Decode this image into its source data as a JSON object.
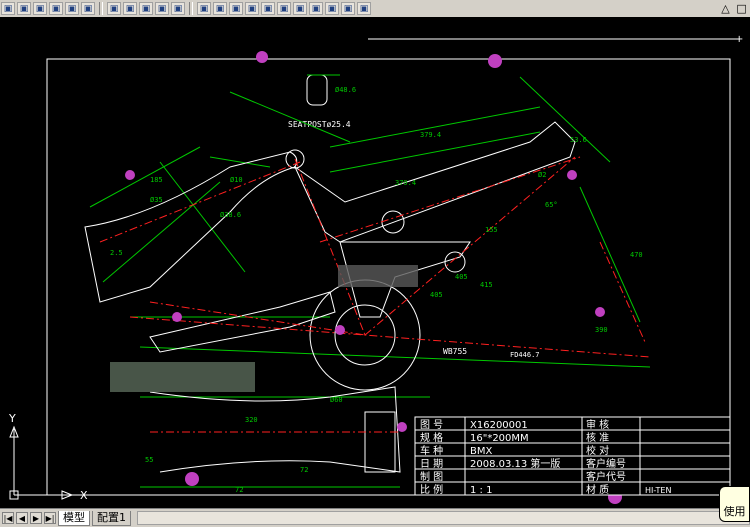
{
  "colors": {
    "bg": "#000000",
    "green": "#00c800",
    "red": "#ff2020",
    "white": "#ffffff",
    "cyan": "#00c8c8",
    "magenta": "#c040c0",
    "yellow": "#ffff00"
  },
  "toolbar": {
    "icons": [
      "box-icon",
      "wedge-icon",
      "cone-icon",
      "sphere-icon",
      "cylinder-icon",
      "torus-icon",
      "layer-icon",
      "view-icon",
      "render-icon",
      "light-icon",
      "material-icon",
      "top-view-icon",
      "bottom-view-icon",
      "left-view-icon",
      "right-view-icon",
      "front-view-icon",
      "back-view-icon",
      "iso-sw-icon",
      "iso-se-icon",
      "iso-ne-icon",
      "iso-nw-icon",
      "camera-icon"
    ]
  },
  "drawing": {
    "seatpost_label": "SEATPOSTø25.4",
    "wb_label": "WB755",
    "dims": [
      "379.4",
      "379.4",
      "FD446.7",
      "Ø48.6",
      "185",
      "Ø35",
      "Ø10",
      "Ø38.6",
      "53.6",
      "Ø2",
      "470",
      "155",
      "320",
      "72",
      "72",
      "55",
      "405",
      "405",
      "415",
      "65°",
      "390",
      "Ø60",
      "2.5"
    ],
    "title_block": {
      "rows": [
        {
          "l1": "图  号",
          "v1": "X16200001",
          "l2": "审  核",
          "v2": ""
        },
        {
          "l1": "规  格",
          "v1": "16\"*200MM",
          "l2": "核  准",
          "v2": ""
        },
        {
          "l1": "车  种",
          "v1": "BMX",
          "l2": "校  对",
          "v2": ""
        },
        {
          "l1": "日  期",
          "v1": "2008.03.13  第一版",
          "l2": "客户编号",
          "v2": ""
        },
        {
          "l1": "制  图",
          "v1": "",
          "l2": "客户代号",
          "v2": ""
        },
        {
          "l1": "比  例",
          "v1": "1 : 1",
          "l2": "材  质",
          "v2": "HI-TEN"
        }
      ]
    },
    "ucs": {
      "x": "X",
      "y": "Y"
    }
  },
  "tabs": {
    "model": "模型",
    "layout1": "配置1"
  },
  "tooltip": "使用"
}
